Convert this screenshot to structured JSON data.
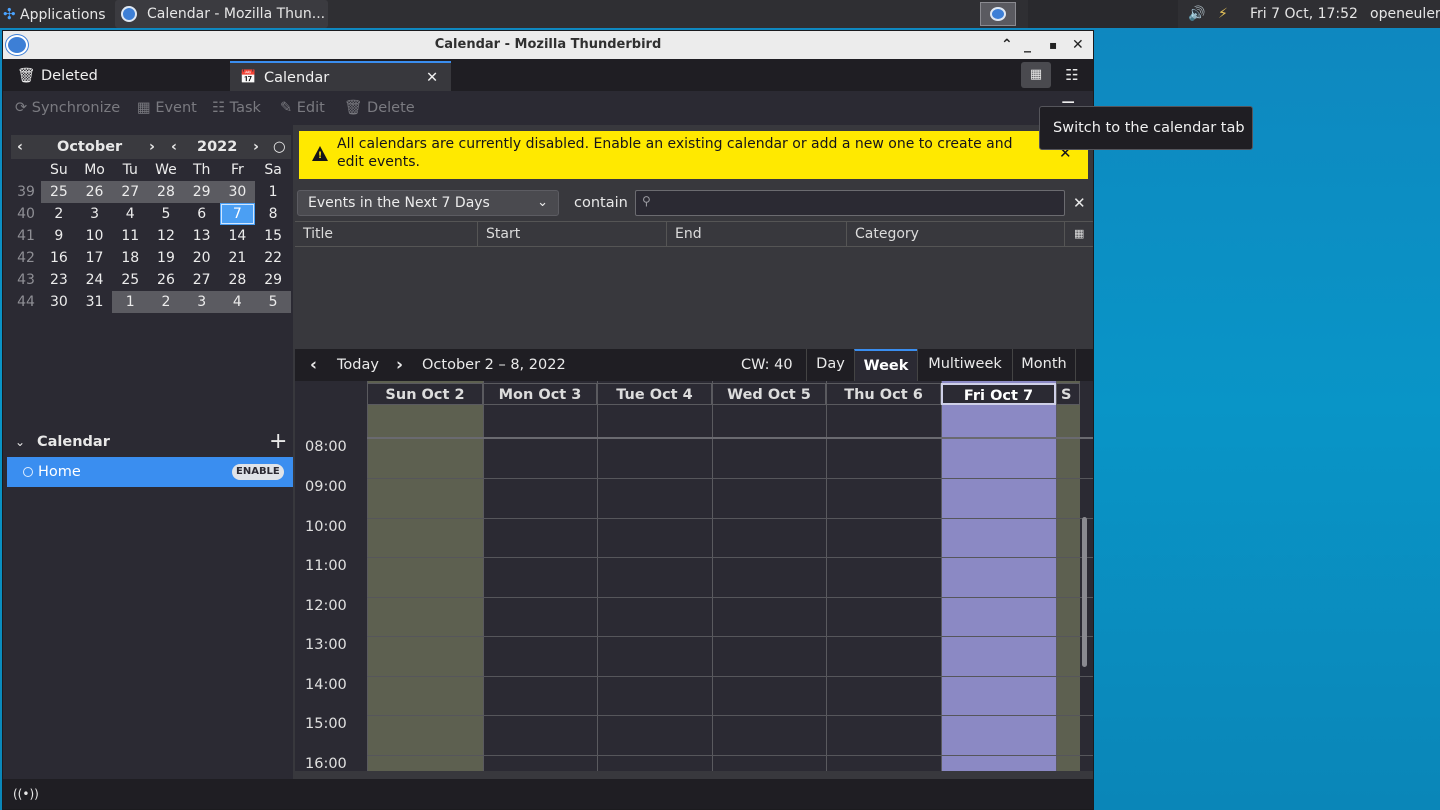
{
  "panel": {
    "apps_label": "Applications",
    "task_title": "Calendar - Mozilla Thun...",
    "datetime": "Fri  7 Oct, 17:52",
    "user": "openeuler"
  },
  "window": {
    "title": "Calendar - Mozilla Thunderbird"
  },
  "tabs": [
    {
      "label": "Deleted"
    },
    {
      "label": "Calendar"
    }
  ],
  "toolbar": {
    "sync": "Synchronize",
    "event": "Event",
    "task": "Task",
    "edit": "Edit",
    "delete": "Delete"
  },
  "tooltip": "Switch to the calendar tab",
  "minimonth": {
    "month": "October",
    "year": "2022",
    "weekday_headers": [
      "Su",
      "Mo",
      "Tu",
      "We",
      "Th",
      "Fr",
      "Sa"
    ],
    "weeks": [
      {
        "wk": "39",
        "days": [
          "25",
          "26",
          "27",
          "28",
          "29",
          "30",
          "1"
        ]
      },
      {
        "wk": "40",
        "days": [
          "2",
          "3",
          "4",
          "5",
          "6",
          "7",
          "8"
        ]
      },
      {
        "wk": "41",
        "days": [
          "9",
          "10",
          "11",
          "12",
          "13",
          "14",
          "15"
        ]
      },
      {
        "wk": "42",
        "days": [
          "16",
          "17",
          "18",
          "19",
          "20",
          "21",
          "22"
        ]
      },
      {
        "wk": "43",
        "days": [
          "23",
          "24",
          "25",
          "26",
          "27",
          "28",
          "29"
        ]
      },
      {
        "wk": "44",
        "days": [
          "30",
          "31",
          "1",
          "2",
          "3",
          "4",
          "5"
        ]
      }
    ]
  },
  "calendar_list": {
    "header": "Calendar",
    "items": [
      {
        "name": "Home",
        "badge": "ENABLE"
      }
    ]
  },
  "notification": "All calendars are currently disabled. Enable an existing calendar or add a new one to create and edit events.",
  "filter": {
    "selected": "Events in the Next 7 Days",
    "contain_label": "contain",
    "search_placeholder": ""
  },
  "list_columns": [
    "Title",
    "Start",
    "End",
    "Category"
  ],
  "nav": {
    "today": "Today",
    "range": "October 2 – 8, 2022",
    "cw": "CW: 40",
    "views": [
      "Day",
      "Week",
      "Multiweek",
      "Month"
    ],
    "selected_view": "Week"
  },
  "week": {
    "days": [
      "Sun Oct 2",
      "Mon Oct 3",
      "Tue Oct 4",
      "Wed Oct 5",
      "Thu Oct 6",
      "Fri Oct 7",
      "S"
    ],
    "hours": [
      "08:00",
      "09:00",
      "10:00",
      "11:00",
      "12:00",
      "13:00",
      "14:00",
      "15:00",
      "16:00"
    ]
  },
  "colors": {
    "accent": "#3a8ef0",
    "weekend": "#5d6050",
    "today": "#8b89c4",
    "notification": "#ffe900"
  }
}
